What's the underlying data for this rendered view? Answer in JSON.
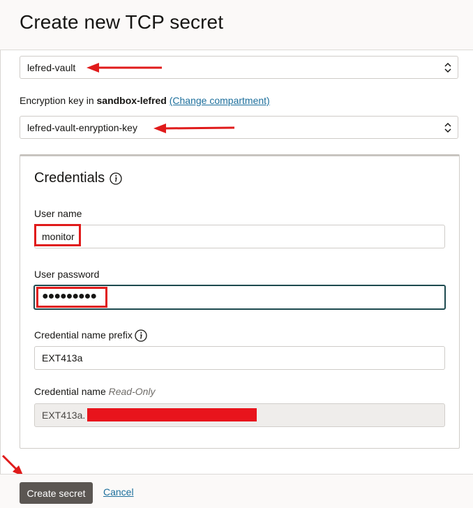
{
  "header": {
    "title": "Create new TCP secret"
  },
  "vault_select": {
    "value": "lefred-vault"
  },
  "encryption": {
    "prefix": "Encryption key in ",
    "compartment": "sandbox-lefred",
    "change_link": "(Change compartment)"
  },
  "key_select": {
    "value": "lefred-vault-enryption-key"
  },
  "credentials": {
    "title": "Credentials",
    "user_name_label": "User name",
    "user_name_value": "monitor",
    "password_label": "User password",
    "password_value": "●●●●●●●●●",
    "prefix_label": "Credential name prefix",
    "prefix_value": "EXT413a",
    "name_label": "Credential name",
    "name_readonly": "Read-Only",
    "name_value": "EXT413a."
  },
  "footer": {
    "create_label": "Create secret",
    "cancel_label": "Cancel"
  },
  "colors": {
    "annotation": "#e01b1b",
    "primary_button": "#5b5652",
    "link": "#1d6f9c",
    "focus_border": "#1d4a4f"
  }
}
